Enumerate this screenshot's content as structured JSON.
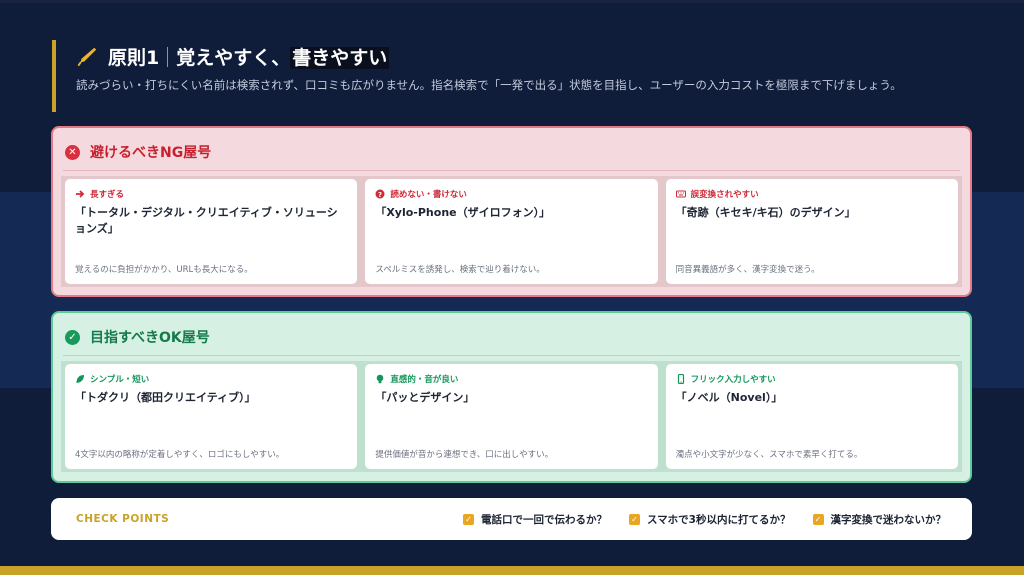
{
  "header": {
    "title_main": "原則1",
    "title_plain": "覚えやすく、",
    "title_highlight": "書きやすい",
    "subtitle": "読みづらい・打ちにくい名前は検索されず、口コミも広がりません。指名検索で「一発で出る」状態を目指し、ユーザーの入力コストを極限まで下げましょう。"
  },
  "colors": {
    "background": "#0f1c3a",
    "accent_gold": "#c9a227",
    "ng_red": "#d8303e",
    "ok_green": "#179a5c",
    "check_orange": "#e9a621"
  },
  "ng": {
    "icon": "x-circle-icon",
    "title": "避けるべきNG屋号",
    "cards": [
      {
        "icon": "arrow-right-icon",
        "tag": "長すぎる",
        "name": "「トータル・デジタル・クリエイティブ・ソリューションズ」",
        "desc": "覚えるのに負担がかかり、URLも長大になる。"
      },
      {
        "icon": "question-circle-icon",
        "tag": "読めない・書けない",
        "name": "「Xylo-Phone（ザイロフォン）」",
        "desc": "スペルミスを誘発し、検索で辿り着けない。"
      },
      {
        "icon": "keyboard-icon",
        "tag": "誤変換されやすい",
        "name": "「奇跡（キセキ/キ石）のデザイン」",
        "desc": "同音異義語が多く、漢字変換で迷う。"
      }
    ]
  },
  "ok": {
    "icon": "check-circle-icon",
    "title": "目指すべきOK屋号",
    "cards": [
      {
        "icon": "leaf-icon",
        "tag": "シンプル・短い",
        "name": "「トダクリ（都田クリエイティブ）」",
        "desc": "4文字以内の略称が定着しやすく、ロゴにもしやすい。"
      },
      {
        "icon": "lightbulb-icon",
        "tag": "直感的・音が良い",
        "name": "「パッとデザイン」",
        "desc": "提供価値が音から連想でき、口に出しやすい。"
      },
      {
        "icon": "smartphone-icon",
        "tag": "フリック入力しやすい",
        "name": "「ノベル（Novel）」",
        "desc": "濁点や小文字が少なく、スマホで素早く打てる。"
      }
    ]
  },
  "checkpoints": {
    "label": "CHECK POINTS",
    "items": [
      "電話口で一回で伝わるか？",
      "スマホで3秒以内に打てるか？",
      "漢字変換で迷わないか？"
    ]
  }
}
